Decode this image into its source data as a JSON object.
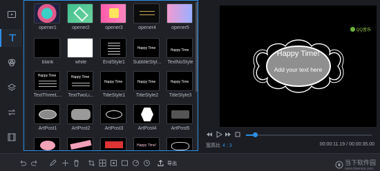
{
  "rail": {
    "items": [
      {
        "name": "media"
      },
      {
        "name": "text"
      },
      {
        "name": "filters"
      },
      {
        "name": "overlays"
      },
      {
        "name": "transitions"
      },
      {
        "name": "film"
      }
    ]
  },
  "assets": [
    {
      "label": "opener1"
    },
    {
      "label": "opener2"
    },
    {
      "label": "opener3"
    },
    {
      "label": "opener4"
    },
    {
      "label": "opener5"
    },
    {
      "label": "blank"
    },
    {
      "label": "white"
    },
    {
      "label": "EndStyle1"
    },
    {
      "label": "SubtitleStyl..."
    },
    {
      "label": "TextNoStyle"
    },
    {
      "label": "TextThreeL..."
    },
    {
      "label": "TextTwoLi..."
    },
    {
      "label": "TitleStyle1"
    },
    {
      "label": "TitleStyle2"
    },
    {
      "label": "TitleStyle3"
    },
    {
      "label": "ArtPost1"
    },
    {
      "label": "ArtPost2"
    },
    {
      "label": "ArtPost3"
    },
    {
      "label": "ArtPost4"
    },
    {
      "label": "ArtPost5"
    }
  ],
  "thumb_text": {
    "happy": "Happy Time",
    "happy_excl": "Happy Time!",
    "sub": "Add your text here"
  },
  "preview": {
    "brand": "QQ音乐",
    "title": "Happy Time!",
    "subtitle": "Add your text here"
  },
  "ratio": {
    "label": "宽高比",
    "value": "4 : 3"
  },
  "timecode": "00:00:11.19 / 00:00:35.00",
  "toolbar": {
    "export_label": "导出"
  },
  "watermark": {
    "main": "当下软件园",
    "sub": "www.downxia.com"
  },
  "colors": {
    "accent": "#2e8fe6",
    "bg": "#1b1d22"
  }
}
